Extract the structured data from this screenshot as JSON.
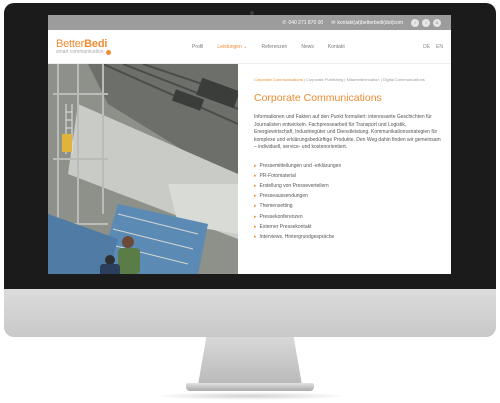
{
  "colors": {
    "accent": "#ef8c33",
    "topbar": "#9c9c9c",
    "bezel": "#1b1b1c"
  },
  "topbar": {
    "phone_icon": "phone-icon",
    "phone": "040 271 870 00",
    "email_icon": "mail-icon",
    "email": "kontakt(at)betterbedi(dot)com",
    "social": [
      {
        "icon": "facebook-icon",
        "glyph": "f"
      },
      {
        "icon": "twitter-icon",
        "glyph": "t"
      },
      {
        "icon": "instagram-icon",
        "glyph": "◘"
      }
    ]
  },
  "logo": {
    "better": "Better",
    "bedi": "Bedi",
    "tagline": "smart communication"
  },
  "nav": [
    {
      "label": "Profil",
      "active": false
    },
    {
      "label": "Leistungen",
      "active": true,
      "chevron": "chevron-down-icon"
    },
    {
      "label": "Referenzen",
      "active": false
    },
    {
      "label": "News",
      "active": false
    },
    {
      "label": "Kontakt",
      "active": false
    }
  ],
  "languages": [
    "DE",
    "EN"
  ],
  "breadcrumb": {
    "current": "Corporate Communications",
    "rest": "| Corporate Publishing | Mitarbeiterinnation | Digital Communications"
  },
  "page": {
    "title": "Corporate Communications",
    "intro": "Informationen und Fakten auf den Punkt formuliert: interessante Geschichten für Journalisten entwickeln. Fachpressearbeit für Transport und Logistik, Energiewirtschaft, Industriegüter und Dienstleistung. Kommunikationsstrategien für komplexe und erklärungsbedürftige Produkte. Den Weg dahin finden wir gemeinsam – individuell, service- und kostenorientiert.",
    "services": [
      "Pressemitteilungen und -erklärungen",
      "PR-Fotomaterial",
      "Erstellung von Presseverteilern",
      "Presseaussendungen",
      "Themensetting",
      "Pressekonferenzen",
      "Externer Pressekontakt",
      "Interviews, Hintergrundgespräche"
    ],
    "list_arrow": "▸"
  }
}
